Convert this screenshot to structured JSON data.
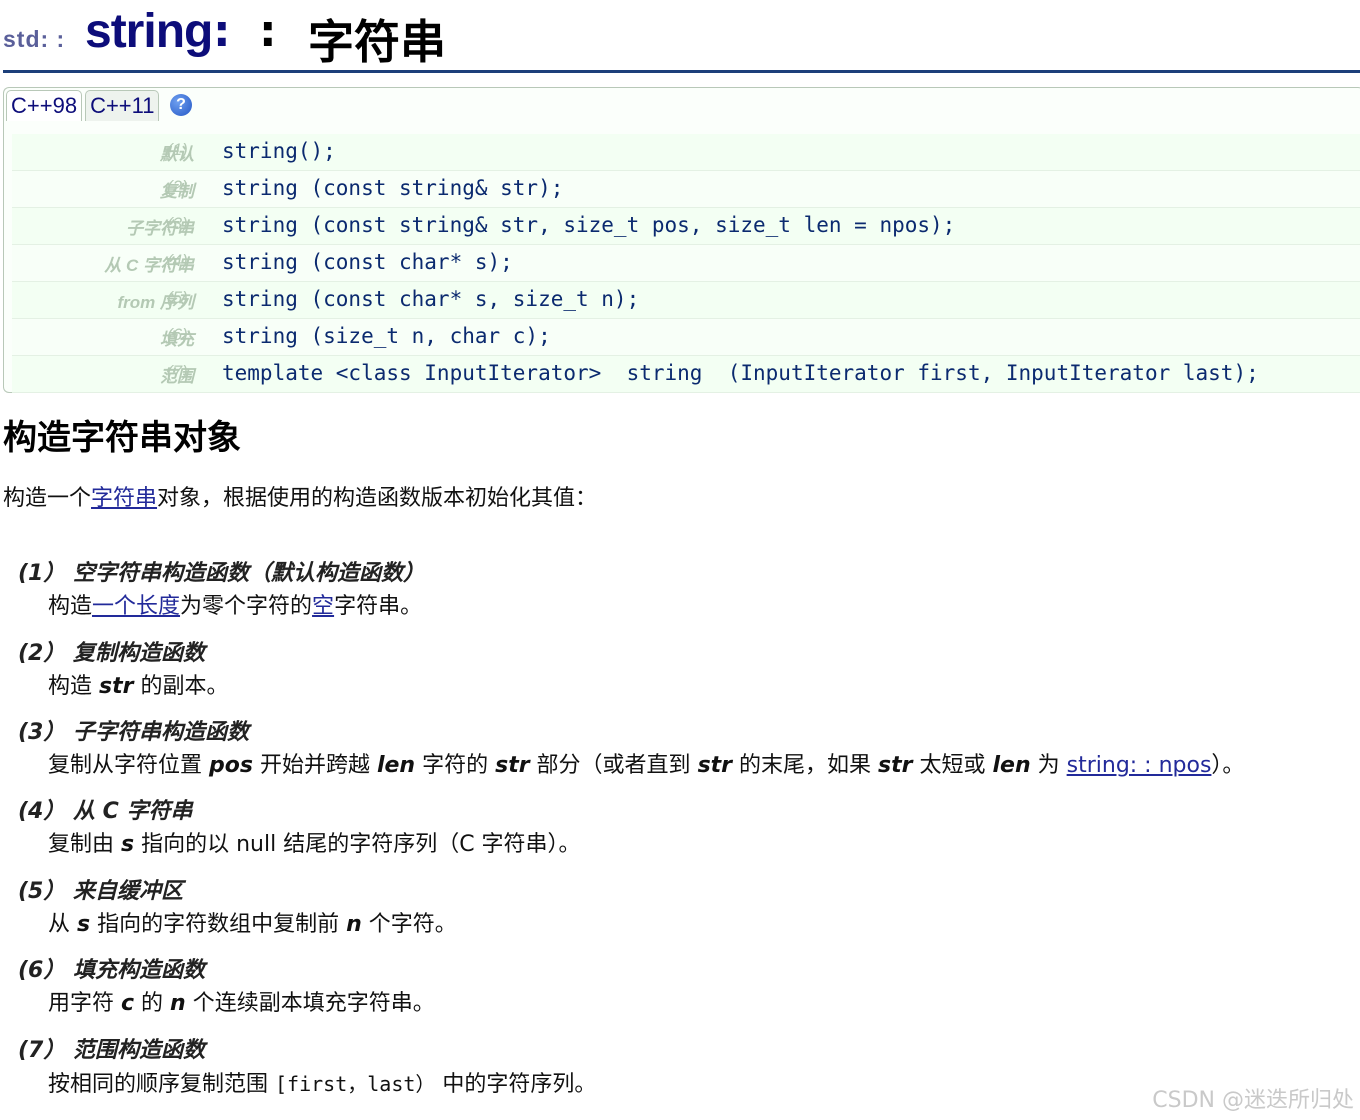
{
  "title": {
    "prefix": "std: :",
    "name": "string",
    "separator_a": ":",
    "separator_b": ":",
    "subtitle": "字符串"
  },
  "tabs": [
    {
      "label": "C++98"
    },
    {
      "label": "C++11"
    }
  ],
  "help_icon": "?",
  "prototypes": [
    {
      "label": "默认",
      "num": "(1)",
      "code": "string();"
    },
    {
      "label": "复制",
      "num": "(2)",
      "code": "string (const string& str);"
    },
    {
      "label": "子字符串",
      "num": "(3)",
      "code": "string (const string& str, size_t pos, size_t len = npos);"
    },
    {
      "label": "从 C 字符串",
      "num": "(4)",
      "code": "string (const char* s);"
    },
    {
      "label": "from 序列",
      "num": "(5)",
      "code": "string (const char* s, size_t n);"
    },
    {
      "label": "填充",
      "num": "(6)",
      "code": "string (size_t n, char c);"
    },
    {
      "label": "范围",
      "num": "(7)",
      "code": "template <class InputIterator>  string  (InputIterator first, InputIterator last);"
    }
  ],
  "section": {
    "heading": "构造字符串对象",
    "intro_before": "构造一个",
    "intro_link": "字符串",
    "intro_after": "对象，根据使用的构造函数版本初始化其值："
  },
  "ctors": {
    "c1": {
      "title": "(1） 空字符串构造函数（默认构造函数）",
      "d1": "构造",
      "link1": "一个长度",
      "d2": "为零个字符的",
      "link2": "空",
      "d3": "字符串。"
    },
    "c2": {
      "title": "(2） 复制构造函数",
      "d1": "构造 ",
      "em1": "str",
      "d2": " 的副本。"
    },
    "c3": {
      "title": "(3） 子字符串构造函数",
      "d1": "复制从字符位置 ",
      "em1": "pos",
      "d2": " 开始并跨越 ",
      "em2": "len",
      "d3": " 字符的 ",
      "em3": "str",
      "d4": " 部分（或者直到 ",
      "em4": "str",
      "d5": " 的末尾，如果 ",
      "em5": "str",
      "d6": " 太短或 ",
      "em6": "len",
      "d7": " 为 ",
      "link": "string: : npos",
      "d8": "）。"
    },
    "c4": {
      "title": "(4） 从 C 字符串",
      "d1": "复制由 ",
      "em1": "s",
      "d2": " 指向的以 null 结尾的字符序列（C 字符串）。"
    },
    "c5": {
      "title": "(5） 来自缓冲区",
      "d1": "从 ",
      "em1": "s",
      "d2": " 指向的字符数组中复制前 ",
      "em2": "n",
      "d3": " 个字符。"
    },
    "c6": {
      "title": "(6） 填充构造函数",
      "d1": "用字符 ",
      "em1": "c",
      "d2": " 的 ",
      "em2": "n",
      "d3": " 个连续副本填充字符串。"
    },
    "c7": {
      "title": "(7） 范围构造函数",
      "d1": "按相同的顺序复制范围 ",
      "code": "[first，last）",
      "d2": " 中的字符序列。"
    }
  },
  "watermark": "CSDN @迷迭所归处"
}
